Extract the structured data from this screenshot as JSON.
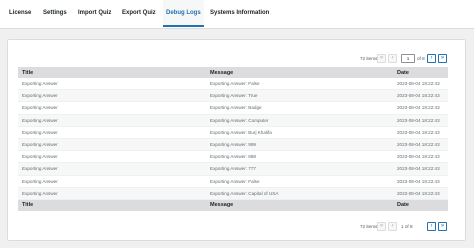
{
  "tabs": [
    {
      "label": "License"
    },
    {
      "label": "Settings"
    },
    {
      "label": "Import Quiz"
    },
    {
      "label": "Export Quiz"
    },
    {
      "label": "Debug Logs"
    },
    {
      "label": "Systems Information"
    }
  ],
  "active_tab": "Debug Logs",
  "pagination": {
    "items_label": "72 items",
    "first": "«",
    "prev": "‹",
    "current_page": "1",
    "of_label": "of 8",
    "of_label_bottom": "1 of 8",
    "next": "›",
    "last": "»"
  },
  "table": {
    "columns": [
      "Title",
      "Message",
      "Date"
    ],
    "rows": [
      {
        "title": "Exporting Answer",
        "message": "Exporting Answer: False",
        "date": "2023-08-04 18:22:43"
      },
      {
        "title": "Exporting Answer",
        "message": "Exporting Answer: True",
        "date": "2023-08-04 18:22:43"
      },
      {
        "title": "Exporting Answer",
        "message": "Exporting Answer: Badge",
        "date": "2023-08-04 18:22:43"
      },
      {
        "title": "Exporting Answer",
        "message": "Exporting Answer: Computer",
        "date": "2023-08-04 18:22:43"
      },
      {
        "title": "Exporting Answer",
        "message": "Exporting Answer: Burj Khalifa",
        "date": "2023-08-04 18:22:43"
      },
      {
        "title": "Exporting Answer",
        "message": "Exporting Answer: 999",
        "date": "2023-08-04 18:22:43"
      },
      {
        "title": "Exporting Answer",
        "message": "Exporting Answer: 888",
        "date": "2023-08-04 18:22:43"
      },
      {
        "title": "Exporting Answer",
        "message": "Exporting Answer: 777",
        "date": "2023-08-04 18:22:43"
      },
      {
        "title": "Exporting Answer",
        "message": "Exporting Answer: False",
        "date": "2023-08-04 18:22:43"
      },
      {
        "title": "Exporting Answer",
        "message": "Exporting Answer: Capital of USA",
        "date": "2023-08-04 18:22:43"
      }
    ]
  },
  "colors": {
    "accent": "#2271b1",
    "header_bg": "#dcdcde",
    "page_bg": "#f0f0f1"
  }
}
